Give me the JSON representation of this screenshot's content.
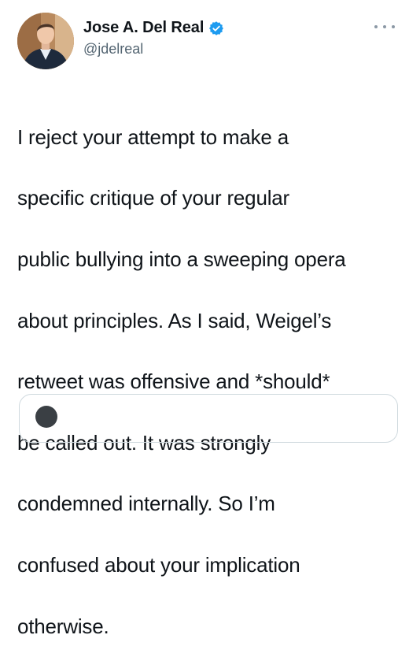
{
  "author": {
    "name": "Jose A. Del Real",
    "handle": "@jdelreal",
    "verified": true,
    "verified_color": "#1d9bf0"
  },
  "tweet": {
    "text_lines": [
      "I reject your attempt to make a",
      "specific critique of your regular",
      "public bullying into a sweeping opera",
      "about principles. As I said, Weigel’s",
      "retweet was offensive and *should*",
      "be called out. It was strongly",
      "condemned internally. So I’m",
      "confused about your implication",
      "otherwise."
    ]
  },
  "icons": {
    "verified": "verified-badge-icon",
    "more": "more-options-icon"
  },
  "colors": {
    "text": "#0f1419",
    "secondary": "#536471",
    "border": "#cfd9de"
  }
}
